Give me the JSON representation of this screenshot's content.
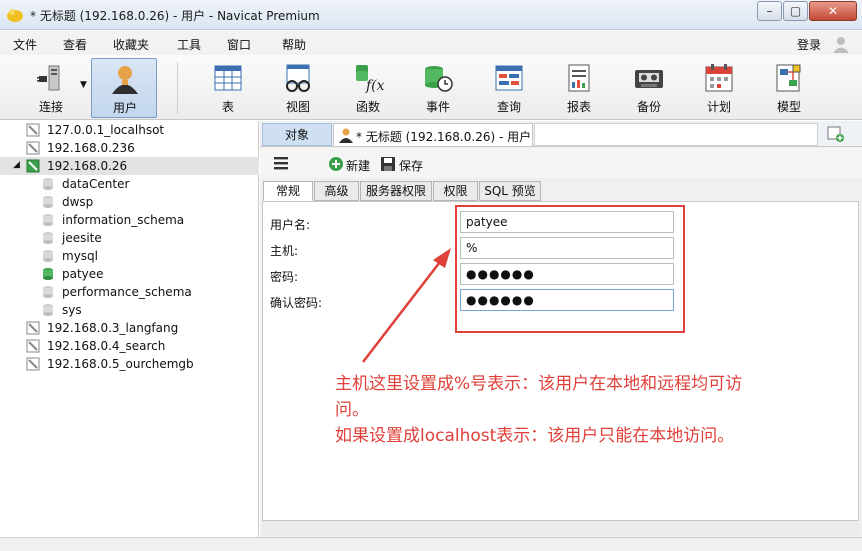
{
  "window": {
    "title": "* 无标题 (192.168.0.26) - 用户 - Navicat Premium",
    "controls": [
      "minimize-icon",
      "restore-icon",
      "close-icon"
    ]
  },
  "menu": {
    "items": [
      "文件",
      "查看",
      "收藏夹",
      "工具",
      "窗口",
      "帮助"
    ],
    "login": "登录"
  },
  "toolbar": {
    "items": [
      {
        "label": "连接",
        "icon": "connection-plug-icon"
      },
      {
        "label": "用户",
        "icon": "user-icon",
        "active": true
      },
      {
        "label": "表",
        "icon": "table-icon"
      },
      {
        "label": "视图",
        "icon": "view-glasses-icon"
      },
      {
        "label": "函数",
        "icon": "function-icon"
      },
      {
        "label": "事件",
        "icon": "event-clock-icon"
      },
      {
        "label": "查询",
        "icon": "query-icon"
      },
      {
        "label": "报表",
        "icon": "report-icon"
      },
      {
        "label": "备份",
        "icon": "backup-tape-icon"
      },
      {
        "label": "计划",
        "icon": "schedule-calendar-icon"
      },
      {
        "label": "模型",
        "icon": "model-icon"
      }
    ]
  },
  "sidebar": {
    "connections": [
      {
        "name": "127.0.0.1_localhsot"
      },
      {
        "name": "192.168.0.236"
      },
      {
        "name": "192.168.0.26",
        "expanded": true,
        "selected": true
      },
      {
        "name": "192.168.0.3_langfang"
      },
      {
        "name": "192.168.0.4_search"
      },
      {
        "name": "192.168.0.5_ourchemgb"
      }
    ],
    "databases": [
      {
        "name": "dataCenter"
      },
      {
        "name": "dwsp"
      },
      {
        "name": "information_schema"
      },
      {
        "name": "jeesite"
      },
      {
        "name": "mysql"
      },
      {
        "name": "patyee",
        "active": true
      },
      {
        "name": "performance_schema"
      },
      {
        "name": "sys"
      }
    ]
  },
  "tabs": {
    "object": "对象",
    "document": "* 无标题 (192.168.0.26) - 用户"
  },
  "editor_toolbar": {
    "new": "新建",
    "save": "保存"
  },
  "property_tabs": [
    "常规",
    "高级",
    "服务器权限",
    "权限",
    "SQL 预览"
  ],
  "form": {
    "labels": {
      "username": "用户名:",
      "host": "主机:",
      "password": "密码:",
      "confirm": "确认密码:"
    },
    "values": {
      "username": "patyee",
      "host": "%",
      "password": "●●●●●●",
      "confirm": "●●●●●●"
    }
  },
  "annotation": {
    "line1": "主机这里设置成%号表示：该用户在本地和远程均可访",
    "line2": "问。",
    "line3": "如果设置成localhost表示：该用户只能在本地访问。",
    "color": "#e0403a"
  }
}
